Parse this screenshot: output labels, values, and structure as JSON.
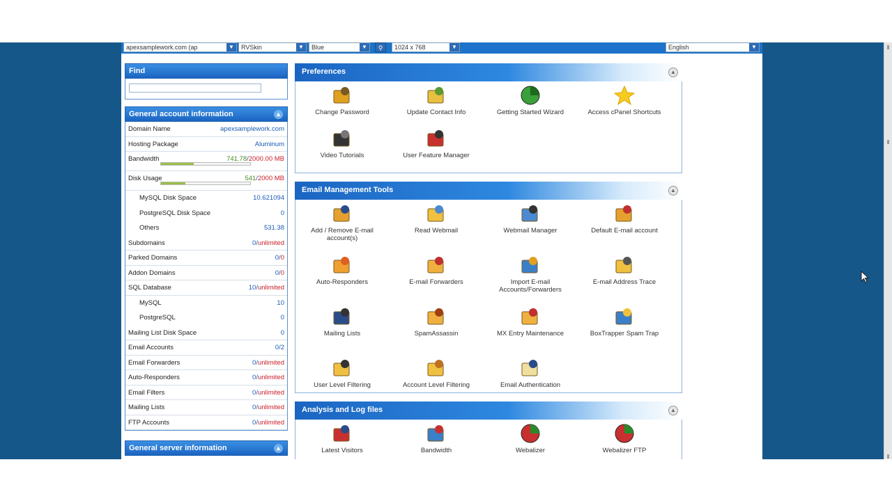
{
  "topbar": {
    "domain_select": "apexsamplework.com (ap",
    "skin_select": "RVSkin",
    "color_select": "Blue",
    "resolution_select": "1024 x 768",
    "language_select": "English"
  },
  "find": {
    "title": "Find",
    "placeholder": ""
  },
  "general_account": {
    "title": "General account information",
    "rows": [
      {
        "label": "Domain Name",
        "value": "apexsamplework.com"
      },
      {
        "label": "Hosting Package",
        "value": "Aluminum"
      },
      {
        "label": "Bandwidth",
        "used": "741.78",
        "limit": "2000.00 MB",
        "fill": 0.37
      },
      {
        "label": "Disk Usage",
        "used": "541",
        "limit": "2000 MB",
        "fill": 0.27
      },
      {
        "label": "MySQL Disk Space",
        "value": "10.621094"
      },
      {
        "label": "PostgreSQL Disk Space",
        "value": "0"
      },
      {
        "label": "Others",
        "value": "531.38"
      },
      {
        "label": "Subdomains",
        "used": "0/",
        "limit": "unlimited"
      },
      {
        "label": "Parked Domains",
        "used": "0/",
        "limit": "0"
      },
      {
        "label": "Addon Domains",
        "used": "0/",
        "limit": "0"
      },
      {
        "label": "SQL Database",
        "used": "10/",
        "limit": "unlimited"
      },
      {
        "label": "MySQL",
        "value": "10"
      },
      {
        "label": "PostgreSQL",
        "value": "0"
      },
      {
        "label": "Mailing List Disk Space",
        "value": "0"
      },
      {
        "label": "Email Accounts",
        "value": "0/2"
      },
      {
        "label": "Email Forwarders",
        "used": "0/",
        "limit": "unlimited"
      },
      {
        "label": "Auto-Responders",
        "used": "0/",
        "limit": "unlimited"
      },
      {
        "label": "Email Filters",
        "used": "0/",
        "limit": "unlimited"
      },
      {
        "label": "Mailing Lists",
        "used": "0/",
        "limit": "unlimited"
      },
      {
        "label": "FTP Accounts",
        "used": "0/",
        "limit": "unlimited"
      }
    ]
  },
  "general_server": {
    "title": "General server information"
  },
  "sections": {
    "preferences": {
      "title": "Preferences",
      "items": [
        {
          "label": "Change Password",
          "icon": "lock-icon"
        },
        {
          "label": "Update Contact Info",
          "icon": "contact-card-icon"
        },
        {
          "label": "Getting Started Wizard",
          "icon": "wizard-icon"
        },
        {
          "label": "Access cPanel Shortcuts",
          "icon": "star-icon"
        },
        {
          "label": "Video Tutorials",
          "icon": "film-icon"
        },
        {
          "label": "User Feature Manager",
          "icon": "users-icon"
        }
      ]
    },
    "email": {
      "title": "Email Management Tools",
      "items": [
        {
          "label": "Add / Remove E-mail\naccount(s)",
          "icon": "email-account-icon"
        },
        {
          "label": "Read Webmail",
          "icon": "webmail-icon"
        },
        {
          "label": "Webmail Manager",
          "icon": "webmail-manager-icon"
        },
        {
          "label": "Default E-mail account",
          "icon": "default-email-icon"
        },
        {
          "label": "Auto-Responders",
          "icon": "autoresponder-icon"
        },
        {
          "label": "E-mail Forwarders",
          "icon": "forwarder-icon"
        },
        {
          "label": "Import E-mail\nAccounts/Forwarders",
          "icon": "import-icon"
        },
        {
          "label": "E-mail Address Trace",
          "icon": "trace-icon"
        },
        {
          "label": "Mailing Lists",
          "icon": "mailing-list-icon"
        },
        {
          "label": "SpamAssassin",
          "icon": "spam-icon"
        },
        {
          "label": "MX Entry Maintenance",
          "icon": "mx-icon"
        },
        {
          "label": "BoxTrapper Spam Trap",
          "icon": "boxtrapper-icon"
        },
        {
          "label": "User Level Filtering",
          "icon": "user-filter-icon"
        },
        {
          "label": "Account Level Filtering",
          "icon": "account-filter-icon"
        },
        {
          "label": "Email Authentication",
          "icon": "email-auth-icon"
        }
      ]
    },
    "logs": {
      "title": "Analysis and Log files",
      "items": [
        {
          "label": "Latest Visitors",
          "icon": "visitor-icon"
        },
        {
          "label": "Bandwidth",
          "icon": "bandwidth-icon"
        },
        {
          "label": "Webalizer",
          "icon": "webalizer-icon"
        },
        {
          "label": "Webalizer FTP",
          "icon": "webalizer-ftp-icon"
        }
      ]
    }
  },
  "colors": {
    "accent": "#1b65c2",
    "background": "#16578a",
    "limit": "#c8202a"
  }
}
